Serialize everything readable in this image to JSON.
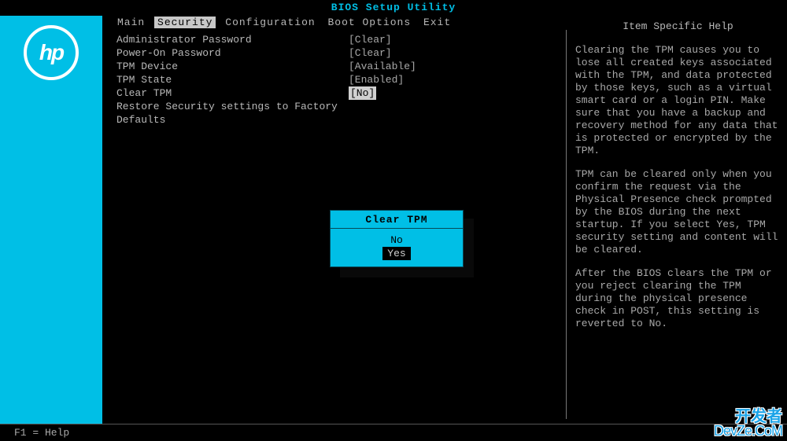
{
  "title": "BIOS Setup Utility",
  "logo_text": "hp",
  "menu": {
    "items": [
      "Main",
      "Security",
      "Configuration",
      "Boot Options",
      "Exit"
    ],
    "selected_index": 1
  },
  "settings": [
    {
      "label": "Administrator Password",
      "value": "[Clear]",
      "highlight": false
    },
    {
      "label": "Power-On Password",
      "value": "[Clear]",
      "highlight": false
    },
    {
      "label": "TPM Device",
      "value": "[Available]",
      "highlight": false
    },
    {
      "label": "TPM State",
      "value": "[Enabled]",
      "highlight": false
    },
    {
      "label": "Clear TPM",
      "value": "[No]",
      "highlight": true
    },
    {
      "label": "Restore Security settings to Factory Defaults",
      "value": "",
      "highlight": false
    }
  ],
  "dialog": {
    "title": "Clear TPM",
    "options": [
      "No",
      "Yes"
    ],
    "selected_index": 1
  },
  "help": {
    "title": "Item Specific Help",
    "paragraphs": [
      "Clearing the TPM causes you to lose all created keys associated with the TPM, and data protected by those keys, such as a virtual smart card or a login PIN. Make sure that you have a backup and recovery method for any data that is protected or encrypted by the TPM.",
      "TPM can be cleared only when you confirm the request via the Physical Presence check prompted by the BIOS during the next startup. If you select Yes, TPM security setting and content will be cleared.",
      "After the BIOS clears the TPM or you reject clearing the TPM during the physical presence check in POST, this setting is reverted to No."
    ]
  },
  "footer": {
    "help_hint": "F1 = Help"
  },
  "watermark": {
    "line1": "开发者",
    "line2": "DevZe.CoM"
  }
}
